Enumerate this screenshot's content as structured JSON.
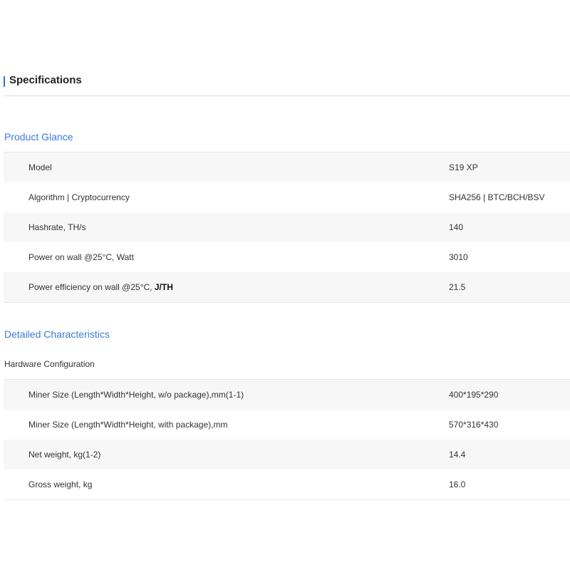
{
  "header": {
    "title": "Specifications"
  },
  "product_glance": {
    "title": "Product Glance",
    "rows": [
      {
        "label": "Model",
        "value": "S19 XP"
      },
      {
        "label": "Algorithm | Cryptocurrency",
        "value": "SHA256 | BTC/BCH/BSV"
      },
      {
        "label": "Hashrate, TH/s",
        "value": "140"
      },
      {
        "label": "Power on wall @25°C, Watt",
        "value": "3010"
      },
      {
        "label": "Power efficiency on wall @25°C,",
        "label_bold": "J/TH",
        "value": "21.5"
      }
    ]
  },
  "detailed": {
    "title": "Detailed Characteristics",
    "subtitle": "Hardware Configuration",
    "rows": [
      {
        "label": "Miner Size (Length*Width*Height, w/o package),mm(1-1)",
        "value": "400*195*290"
      },
      {
        "label": "Miner Size (Length*Width*Height, with package),mm",
        "value": "570*316*430"
      },
      {
        "label": "Net weight, kg(1-2)",
        "value": "14.4"
      },
      {
        "label": "Gross weight, kg",
        "value": "16.0"
      }
    ]
  },
  "colors": {
    "accent": "#2f6fd6",
    "section_title": "#3d7ad8",
    "row_alt": "#f7f7f7"
  }
}
